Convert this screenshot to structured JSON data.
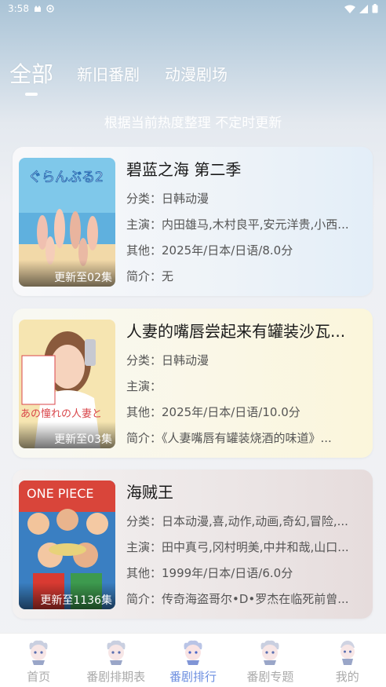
{
  "status_bar": {
    "time": "3:58"
  },
  "tabs": [
    {
      "label": "全部",
      "active": true
    },
    {
      "label": "新旧番剧",
      "active": false
    },
    {
      "label": "动漫剧场",
      "active": false
    }
  ],
  "subtitle": "根据当前热度整理 不定时更新",
  "anime": [
    {
      "title": "碧蓝之海 第二季",
      "badge": "更新至02集",
      "category": "分类：日韩动漫",
      "cast": "主演：内田雄马,木村良平,安元洋贵,小西...",
      "other": "其他：2025年/日本/日语/8.0分",
      "intro": "简介：无",
      "cover_title": "ぐらんぶる2",
      "cover_colors": [
        "#7fc8ea",
        "#f2d9a8"
      ]
    },
    {
      "title": "人妻的嘴唇尝起来有罐装沙瓦...",
      "badge": "更新至03集",
      "category": "分类：日韩动漫",
      "cast": "主演：",
      "other": "其他：2025年/日本/日语/10.0分",
      "intro": "简介：《人妻嘴唇有罐装烧酒的味道》...",
      "cover_title": "あの憧れの人妻と",
      "cover_colors": [
        "#f4d55a",
        "#f7efe0"
      ]
    },
    {
      "title": "海贼王",
      "badge": "更新至1136集",
      "category": "分类：日本动漫,喜,动作,动画,奇幻,冒险,...",
      "cast": "主演：田中真弓,冈村明美,中井和哉,山口...",
      "other": "其他：1999年/日本/日语/6.0分",
      "intro": "简介：传奇海盗哥尔•D•罗杰在临死前曾...",
      "cover_title": "ONE PIECE",
      "cover_colors": [
        "#d9453a",
        "#3a7fc2"
      ]
    }
  ],
  "bottom_nav": [
    {
      "label": "首页",
      "active": false
    },
    {
      "label": "番剧排期表",
      "active": false
    },
    {
      "label": "番剧排行",
      "active": true
    },
    {
      "label": "番剧专题",
      "active": false
    },
    {
      "label": "我的",
      "active": false
    }
  ]
}
